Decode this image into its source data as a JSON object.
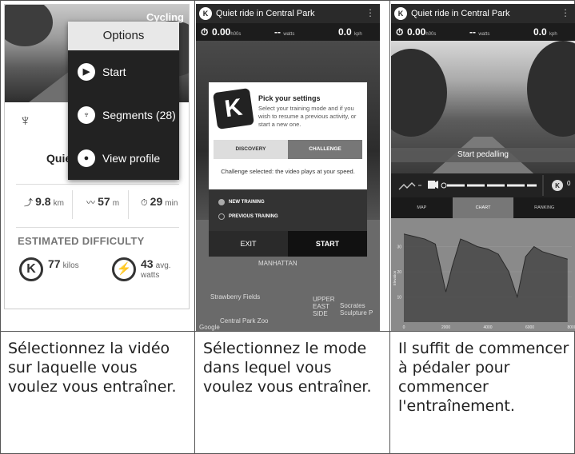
{
  "captions": [
    "Sélectionnez la vidéo sur laquelle vous voulez vous entraîner.",
    "Sélectionnez le mode dans lequel vous voulez vous entraîner.",
    "Il suffit de commencer à pédaler pour commencer l'entraînement."
  ],
  "panel1": {
    "header_tag": "Cycling",
    "title": "Quiet",
    "stats": [
      {
        "value": "9.8",
        "unit": "km"
      },
      {
        "value": "57",
        "unit": "m"
      },
      {
        "value": "29",
        "unit": "min"
      }
    ],
    "estimated_difficulty": "ESTIMATED DIFFICULTY",
    "difficulty": [
      {
        "value": "77",
        "unit": "kilos"
      },
      {
        "value": "43",
        "unit": "avg. watts"
      }
    ],
    "menu": {
      "title": "Options",
      "items": [
        "Start",
        "Segments (28)",
        "View profile"
      ]
    }
  },
  "panel2": {
    "title": "Quiet ride in Central Park",
    "metrics": {
      "time": "0.00",
      "time_unit": "h00s",
      "power": "--",
      "power_unit": "watts",
      "speed": "0.0",
      "speed_unit": "kph"
    },
    "dialog": {
      "heading": "Pick your settings",
      "description": "Select your training mode and if you wish to resume a previous activity, or start a new one.",
      "tabs": [
        "DISCOVERY",
        "CHALLENGE"
      ],
      "selected_text": "Challenge selected: the video plays at your speed.",
      "options": [
        "NEW TRAINING",
        "PREVIOUS TRAINING"
      ],
      "exit": "EXIT",
      "start": "START"
    },
    "map_labels": [
      "MANHATTAN",
      "Strawberry Fields",
      "UPPER EAST SIDE",
      "Socrates Sculpture P",
      "Central Park Zoo",
      "Google"
    ]
  },
  "panel3": {
    "title": "Quiet ride in Central Park",
    "metrics": {
      "time": "0.00",
      "time_unit": "h00s",
      "power": "--",
      "power_unit": "watts",
      "speed": "0.0",
      "speed_unit": "kph"
    },
    "start_pedalling": "Start pedalling",
    "k_count": "0",
    "tabs": [
      "MAP",
      "CHART",
      "RANKING"
    ],
    "chart_data": {
      "type": "area",
      "ylabel": "Elevation",
      "ylim": [
        0,
        40
      ],
      "yticks": [
        "30",
        "20",
        "10"
      ],
      "xticks": [
        "0",
        "2000",
        "4000",
        "6000",
        "8000"
      ],
      "x": [
        0,
        500,
        1000,
        1500,
        2000,
        2300,
        2700,
        3000,
        3500,
        4000,
        4500,
        5000,
        5400,
        5800,
        6200,
        6600,
        7000,
        7400,
        7800
      ],
      "values": [
        35,
        34,
        33,
        31,
        12,
        22,
        33,
        32,
        30,
        29,
        27,
        20,
        10,
        26,
        30,
        28,
        27,
        26,
        25
      ]
    }
  }
}
